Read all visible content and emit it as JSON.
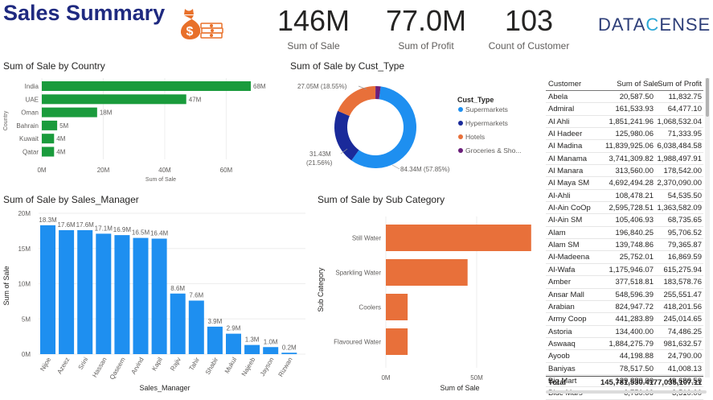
{
  "header": {
    "title": "Sales Summary",
    "logo": {
      "part1": "DATA",
      "part2": "C",
      "part3": "ENSE"
    }
  },
  "kpis": [
    {
      "value": "146M",
      "label": "Sum of Sale"
    },
    {
      "value": "77.0M",
      "label": "Sum of Profit"
    },
    {
      "value": "103",
      "label": "Count of Customer"
    }
  ],
  "colors": {
    "green": "#1a9b3c",
    "blue": "#1e8ff0",
    "navy": "#1a2a9a",
    "orange": "#e8703a",
    "purple": "#6b1f7a"
  },
  "charts": {
    "country": {
      "title": "Sum of Sale by Country",
      "ylabel": "Country",
      "xlabel": "Sum of Sale",
      "type": "bar",
      "categories": [
        "India",
        "UAE",
        "Oman",
        "Bahrain",
        "Kuwait",
        "Qatar"
      ],
      "values": [
        68,
        47,
        18,
        5,
        4,
        4
      ],
      "data_labels": [
        "68M",
        "47M",
        "18M",
        "5M",
        "4M",
        "4M"
      ],
      "xticks": [
        "0M",
        "20M",
        "40M",
        "60M"
      ],
      "xlim": [
        0,
        68
      ]
    },
    "cust_type": {
      "title": "Sum of Sale by Cust_Type",
      "legend_title": "Cust_Type",
      "legend": [
        "Supermarkets",
        "Hypermarkets",
        "Hotels",
        "Groceries & Sho..."
      ],
      "values": [
        84.34,
        31.43,
        27.05,
        2.96
      ],
      "labels": [
        "84.34M (57.85%)",
        "31.43M",
        "(21.56%)",
        "27.05M (18.55%)"
      ]
    },
    "sales_manager": {
      "title": "Sum of Sale by Sales_Manager",
      "ylabel": "Sum of Sale",
      "xlabel": "Sales_Manager",
      "categories": [
        "Nijoe",
        "Azeez",
        "Srini",
        "Hassan",
        "Qaseem",
        "Arvind",
        "Kapil",
        "Rajiv",
        "Tahir",
        "Shabir",
        "Mukul",
        "Najeeb",
        "Jayson",
        "Rizwan"
      ],
      "values": [
        18.3,
        17.6,
        17.6,
        17.1,
        16.9,
        16.5,
        16.4,
        8.6,
        7.6,
        3.9,
        2.9,
        1.3,
        1.0,
        0.2
      ],
      "data_labels": [
        "18.3M",
        "17.6M",
        "17.6M",
        "17.1M",
        "16.9M",
        "16.5M",
        "16.4M",
        "8.6M",
        "7.6M",
        "3.9M",
        "2.9M",
        "1.3M",
        "1.0M",
        "0.2M"
      ],
      "yticks": [
        "0M",
        "5M",
        "10M",
        "15M",
        "20M"
      ],
      "ylim": [
        0,
        20
      ]
    },
    "sub_category": {
      "title": "Sum of Sale by Sub Category",
      "ylabel": "Sub Category",
      "xlabel": "Sum of Sale",
      "categories": [
        "Still Water",
        "Sparkling Water",
        "Coolers",
        "Flavoured Water"
      ],
      "values": [
        80,
        45,
        12,
        12
      ],
      "xticks": [
        "0M",
        "50M"
      ]
    }
  },
  "chart_data": [
    {
      "type": "bar",
      "title": "Sum of Sale by Country",
      "xlabel": "Sum of Sale",
      "ylabel": "Country",
      "categories": [
        "India",
        "UAE",
        "Oman",
        "Bahrain",
        "Kuwait",
        "Qatar"
      ],
      "values": [
        68,
        47,
        18,
        5,
        4,
        4
      ],
      "unit": "M"
    },
    {
      "type": "pie",
      "title": "Sum of Sale by Cust_Type",
      "categories": [
        "Supermarkets",
        "Hypermarkets",
        "Hotels",
        "Groceries & Sho..."
      ],
      "values": [
        84.34,
        31.43,
        27.05,
        2.96
      ],
      "unit": "M"
    },
    {
      "type": "bar",
      "title": "Sum of Sale by Sales_Manager",
      "xlabel": "Sales_Manager",
      "ylabel": "Sum of Sale",
      "categories": [
        "Nijoe",
        "Azeez",
        "Srini",
        "Hassan",
        "Qaseem",
        "Arvind",
        "Kapil",
        "Rajiv",
        "Tahir",
        "Shabir",
        "Mukul",
        "Najeeb",
        "Jayson",
        "Rizwan"
      ],
      "values": [
        18.3,
        17.6,
        17.6,
        17.1,
        16.9,
        16.5,
        16.4,
        8.6,
        7.6,
        3.9,
        2.9,
        1.3,
        1.0,
        0.2
      ],
      "ylim": [
        0,
        20
      ],
      "unit": "M"
    },
    {
      "type": "bar",
      "title": "Sum of Sale by Sub Category",
      "xlabel": "Sum of Sale",
      "ylabel": "Sub Category",
      "categories": [
        "Still Water",
        "Sparkling Water",
        "Coolers",
        "Flavoured Water"
      ],
      "values": [
        80,
        45,
        12,
        12
      ],
      "unit": "M"
    }
  ],
  "table": {
    "headers": [
      "Customer",
      "Sum of Sale",
      "Sum of Profit"
    ],
    "rows": [
      [
        "Abela",
        "20,587.50",
        "11,832.75"
      ],
      [
        "Admiral",
        "161,533.93",
        "64,477.10"
      ],
      [
        "Al Ahli",
        "1,851,241.96",
        "1,068,532.04"
      ],
      [
        "Al Hadeer",
        "125,980.06",
        "71,333.95"
      ],
      [
        "Al Madina",
        "11,839,925.06",
        "6,038,484.58"
      ],
      [
        "Al Manama",
        "3,741,309.82",
        "1,988,497.91"
      ],
      [
        "Al Manara",
        "313,560.00",
        "178,542.00"
      ],
      [
        "Al Maya SM",
        "4,692,494.28",
        "2,370,090.00"
      ],
      [
        "Al-Ahli",
        "108,478.21",
        "54,535.50"
      ],
      [
        "Al-Ain CoOp",
        "2,595,728.51",
        "1,363,582.09"
      ],
      [
        "Al-Ain SM",
        "105,406.93",
        "68,735.65"
      ],
      [
        "Alam",
        "196,840.25",
        "95,706.52"
      ],
      [
        "Alam SM",
        "139,748.86",
        "79,365.87"
      ],
      [
        "Al-Madeena",
        "25,752.01",
        "16,869.59"
      ],
      [
        "Al-Wafa",
        "1,175,946.07",
        "615,275.94"
      ],
      [
        "Amber",
        "377,518.81",
        "183,578.76"
      ],
      [
        "Ansar Mall",
        "548,596.39",
        "255,551.47"
      ],
      [
        "Arabian",
        "824,947.72",
        "418,201.56"
      ],
      [
        "Army Coop",
        "441,283.89",
        "245,014.65"
      ],
      [
        "Astoria",
        "134,400.00",
        "74,486.25"
      ],
      [
        "Aswaaq",
        "1,884,275.79",
        "981,632.57"
      ],
      [
        "Ayoob",
        "44,198.88",
        "24,790.00"
      ],
      [
        "Baniyas",
        "78,517.50",
        "41,008.13"
      ],
      [
        "Big Mart",
        "129,880.00",
        "49,686.50"
      ],
      [
        "Blue Mars",
        "6,750.00",
        "3,510.00"
      ]
    ],
    "total": [
      "Total",
      "145,781,530.41",
      "77,035,107.11"
    ]
  }
}
